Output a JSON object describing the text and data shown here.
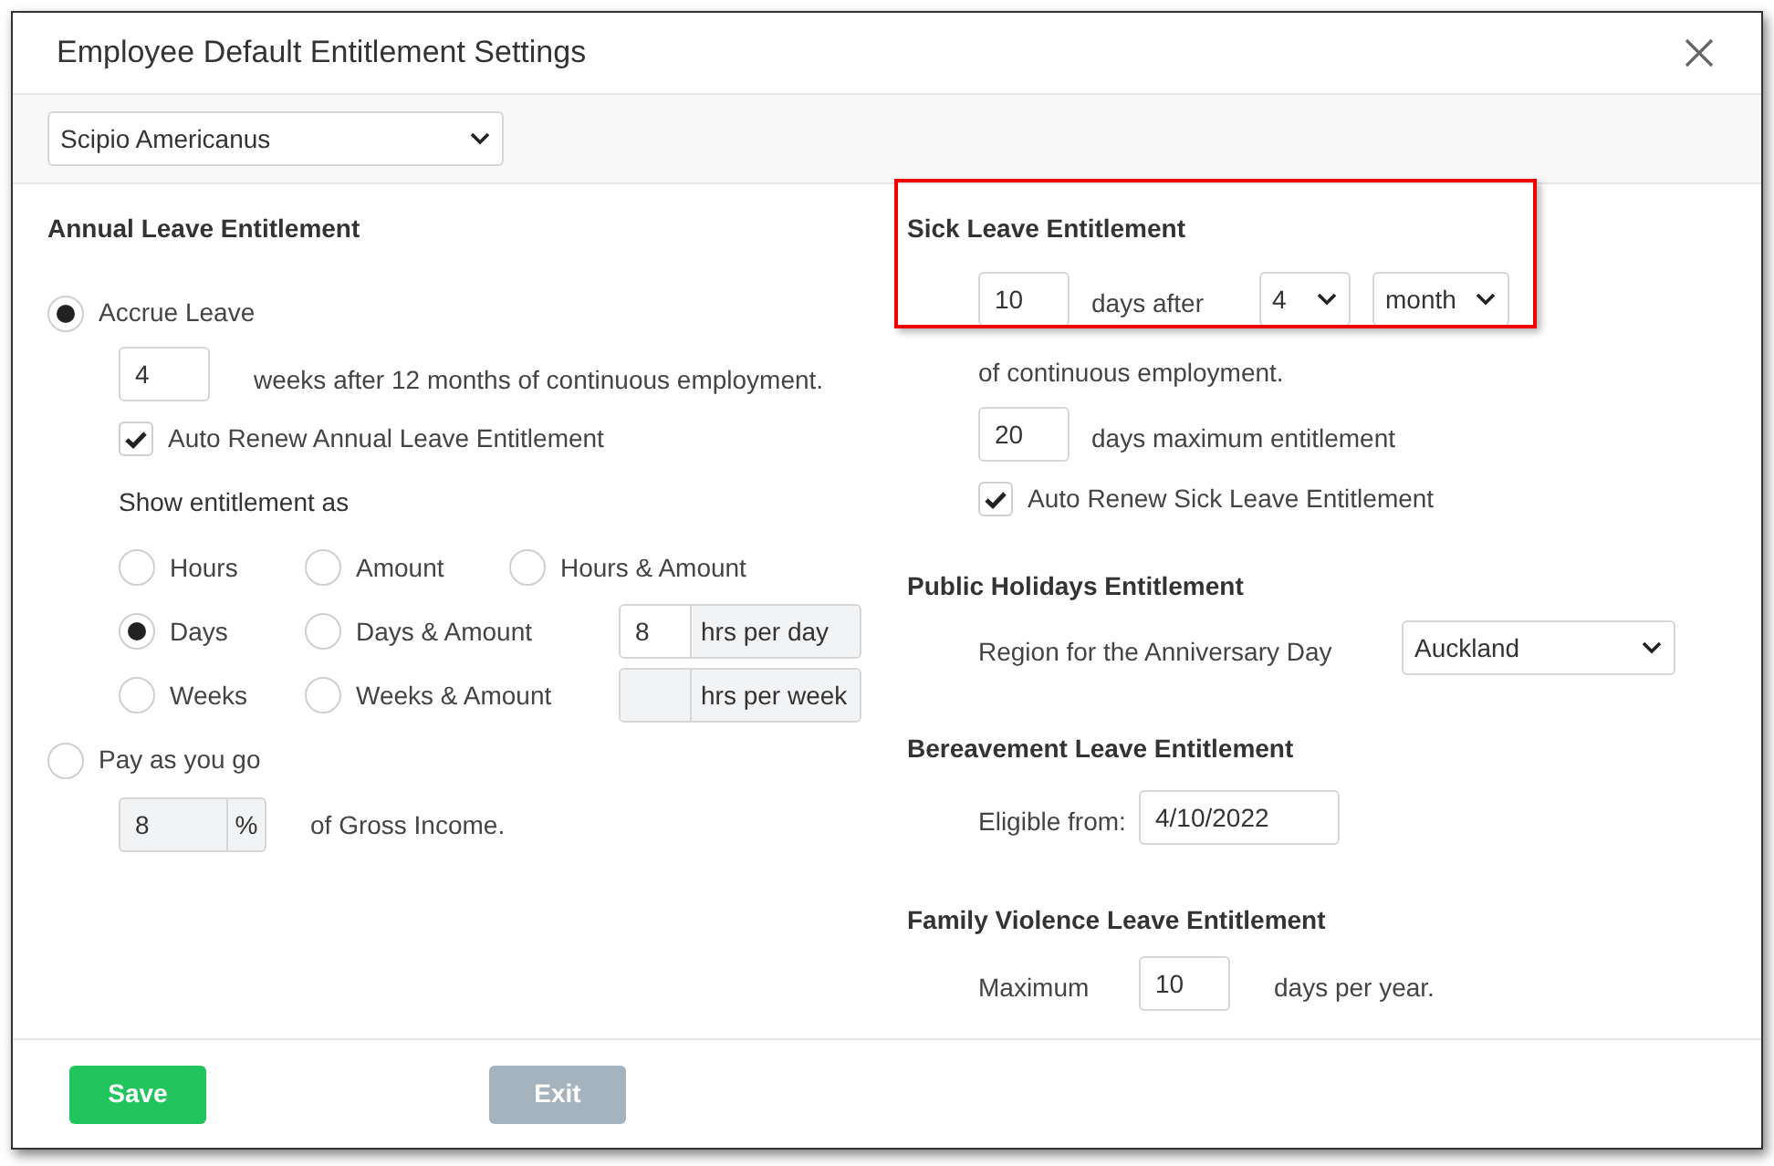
{
  "window": {
    "title": "Employee Default Entitlement Settings"
  },
  "employee_select": {
    "value": "Scipio Americanus"
  },
  "annual_leave": {
    "heading": "Annual Leave Entitlement",
    "modes": [
      {
        "label": "Accrue Leave",
        "selected": true
      },
      {
        "label": "Pay as you go",
        "selected": false
      }
    ],
    "weeks": {
      "value": "4",
      "text": "weeks after 12 months of continuous employment."
    },
    "auto_renew": {
      "label": "Auto Renew Annual Leave Entitlement",
      "checked": true
    },
    "show_as_label": "Show entitlement as",
    "show_as_options": [
      {
        "label": "Hours",
        "selected": false
      },
      {
        "label": "Amount",
        "selected": false
      },
      {
        "label": "Hours & Amount",
        "selected": false
      },
      {
        "label": "Days",
        "selected": true
      },
      {
        "label": "Days & Amount",
        "selected": false
      },
      {
        "label": "Weeks",
        "selected": false
      },
      {
        "label": "Weeks & Amount",
        "selected": false
      }
    ],
    "hours_per_day": {
      "value": "8",
      "unit": "hrs per day"
    },
    "hours_per_week": {
      "unit": "hrs per week"
    },
    "pay_as_you_go": {
      "value": "8",
      "unit": "%",
      "text": "of Gross Income."
    }
  },
  "sick_leave": {
    "heading": "Sick Leave Entitlement",
    "highlighted": true,
    "days": {
      "value": "10",
      "text": "days after"
    },
    "period_number": "4",
    "period_unit": "month",
    "continuation": "of continuous employment.",
    "maximum": {
      "value": "20",
      "text": "days maximum entitlement"
    },
    "auto_renew": {
      "label": "Auto Renew Sick Leave Entitlement",
      "checked": true
    }
  },
  "public_holidays": {
    "heading": "Public Holidays Entitlement",
    "label": "Region for the Anniversary Day",
    "region": "Auckland"
  },
  "bereavement": {
    "heading": "Bereavement Leave Entitlement",
    "label": "Eligible from:",
    "date": "4/10/2022"
  },
  "family_violence": {
    "heading": "Family Violence Leave Entitlement",
    "label": "Maximum",
    "value": "10",
    "text": "days per year."
  },
  "buttons": [
    {
      "label": "Save",
      "disabled": false
    },
    {
      "label": "Exit",
      "disabled": true
    }
  ]
}
